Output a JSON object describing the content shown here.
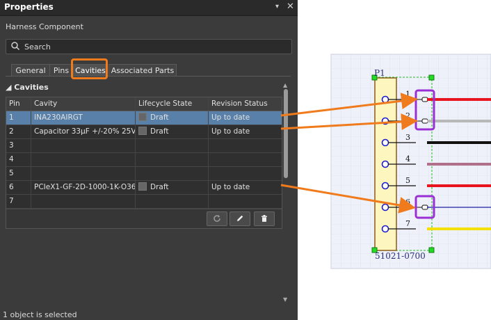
{
  "panel": {
    "title": "Properties",
    "pin_glyph": "▾",
    "close_glyph": "✕",
    "subtitle": "Harness Component",
    "search_placeholder": "Search",
    "tabs": [
      "General",
      "Pins",
      "Cavities",
      "Associated Parts"
    ],
    "active_tab": "Cavities",
    "section_title": "Cavities",
    "columns": [
      "Pin",
      "Cavity",
      "Lifecycle State",
      "Revision Status"
    ],
    "rows": [
      {
        "pin": "1",
        "cavity": "INA230AIRGT",
        "lifecycle": "Draft",
        "revision": "Up to date",
        "selected": true
      },
      {
        "pin": "2",
        "cavity": "Capacitor 33µF +/-20% 25V",
        "lifecycle": "Draft",
        "revision": "Up to date",
        "selected": false
      },
      {
        "pin": "3",
        "cavity": "",
        "lifecycle": "",
        "revision": "",
        "selected": false
      },
      {
        "pin": "4",
        "cavity": "",
        "lifecycle": "",
        "revision": "",
        "selected": false
      },
      {
        "pin": "5",
        "cavity": "",
        "lifecycle": "",
        "revision": "",
        "selected": false
      },
      {
        "pin": "6",
        "cavity": "PCIeX1-GF-2D-1000-1K-O36",
        "lifecycle": "Draft",
        "revision": "Up to date",
        "selected": false
      },
      {
        "pin": "7",
        "cavity": "",
        "lifecycle": "",
        "revision": "",
        "selected": false
      }
    ],
    "toolbar_icons": [
      "refresh-icon",
      "pencil-icon",
      "trash-icon"
    ],
    "status": "1 object is selected"
  },
  "schematic": {
    "designator": "P1",
    "part_number": "51021-0700",
    "pins": [
      "1",
      "2",
      "3",
      "4",
      "5",
      "6",
      "7"
    ],
    "wire_colors": [
      "#e8141e",
      "#b8b8b8",
      "#111111",
      "#b0708a",
      "#e8141e",
      "#1c1ca8",
      "#f4e000"
    ],
    "accent_orange": "#f07b1c",
    "accent_purple": "#9a2fd6"
  }
}
